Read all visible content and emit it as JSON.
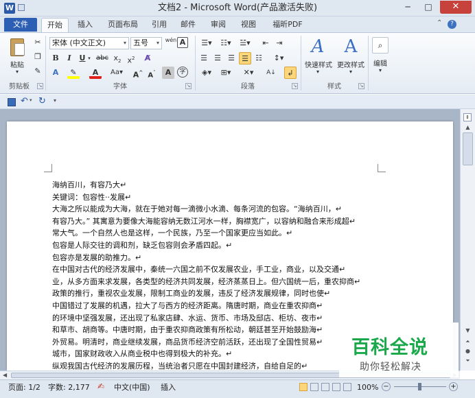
{
  "window": {
    "title": "文档2 - Microsoft Word(产品激活失败)",
    "app_icon": "W"
  },
  "tabs": {
    "file": "文件",
    "items": [
      "开始",
      "插入",
      "页面布局",
      "引用",
      "邮件",
      "审阅",
      "视图",
      "福昕PDF"
    ]
  },
  "ribbon": {
    "clipboard": {
      "paste": "粘贴",
      "label": "剪贴板"
    },
    "font": {
      "name": "宋体 (中文正文)",
      "size": "五号",
      "label": "字体",
      "wen": "wén",
      "A_box": "A"
    },
    "paragraph": {
      "label": "段落"
    },
    "styles": {
      "quick_styles": "快速样式",
      "change_styles": "更改样式",
      "label": "样式"
    },
    "editing": {
      "label": "编辑"
    }
  },
  "document": {
    "lines": [
      "海纳百川，有容乃大↵",
      "关键词：包容性··发展↵",
      "大海之所以能成为大海，就在于她对每一滴微小水滴、每条河流的包容。“海纳百川，↵",
      "有容乃大。” 其寓意为要像大海能容纳无数江河水一样，胸襟宽广，以容纳和融合来形成超↵",
      "常大气。一个自然人也是这样，一个民族，乃至一个国家更应当如此。↵",
      "包容是人际交往的调和剂，缺乏包容则会矛盾四起。↵",
      "包容亦是发展的助推力。↵",
      "在中国对古代的经济发展中，秦统一六国之前不仅发展农业，手工业，商业，以及交通↵",
      "业，从多方面来求发展，各类型的经济共同发展，经济蒸蒸日上。但六国统一后，重农抑商↵",
      "政策的推行，重视农业发展，限制工商业的发展，违反了经济发展规律，同时也使↵",
      "中国错过了发展的机遇，拉大了与西方的经济距离。隋唐时期，商业在重农抑商↵",
      "的环境中坚强发展，还出现了私家店肆、水运、货币、市场及邸店、柜坊、夜市↵",
      "和草市、胡商等。中唐时期，由于重农抑商政策有所松动，朝廷甚至开始鼓励海↵",
      "外贸易。明清时，商业继续发展，商品货币经济空前活跃，还出现了全国性贸易↵",
      "城市，国家财政收入从商业税中也得到极大的补充。↵",
      "纵观我国古代经济的发展历程，当统治者只愿在中国封建经济，自给自足的↵"
    ]
  },
  "status": {
    "page": "页面: 1/2",
    "words": "字数: 2,177",
    "language": "中文(中国)",
    "mode": "插入",
    "zoom": "100%"
  },
  "watermark": {
    "title": "百科全说",
    "subtitle": "助你轻松解决"
  },
  "colors": {
    "file_tab": "#2c5fb3",
    "close": "#c7423a",
    "highlight": "#ffff00",
    "font_color": "#e0201b",
    "watermark_green": "#1aa84a"
  }
}
